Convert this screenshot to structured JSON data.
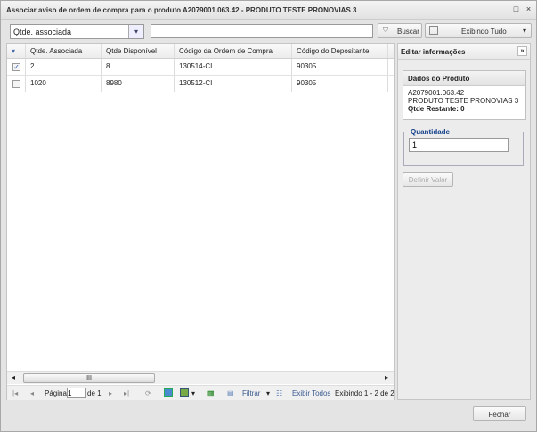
{
  "window": {
    "title": "Associar aviso de ordem de compra para o produto A2079001.063.42 - PRODUTO TESTE PRONOVIAS 3",
    "maximize": "□",
    "close": "×"
  },
  "toolbar": {
    "field_select": "Qtde. associada",
    "search_value": "",
    "search_button": "Buscar",
    "view_button": "Exibindo Tudo"
  },
  "grid": {
    "columns": [
      "Qtde. Associada",
      "Qtde Disponível",
      "Código da Ordem de Compra",
      "Código do Depositante"
    ],
    "rows": [
      {
        "checked": true,
        "cells": [
          "2",
          "8",
          "130514-CI",
          "90305"
        ]
      },
      {
        "checked": false,
        "cells": [
          "1020",
          "8980",
          "130512-CI",
          "90305"
        ]
      }
    ]
  },
  "pager": {
    "page_label": "Página",
    "page": "1",
    "of_label": "de 1",
    "filter": "Filtrar",
    "show_all": "Exibir Todos",
    "status": "Exibindo 1 - 2 de 2"
  },
  "panel": {
    "title": "Editar informações",
    "product_header": "Dados do Produto",
    "product_code": "A2079001.063.42",
    "product_name": "PRODUTO TESTE PRONOVIAS 3",
    "remaining": "Qtde Restante: 0",
    "qty_legend": "Quantidade",
    "qty_value": "1",
    "set_value": "Definir Valor"
  },
  "footer": {
    "close": "Fechar"
  }
}
